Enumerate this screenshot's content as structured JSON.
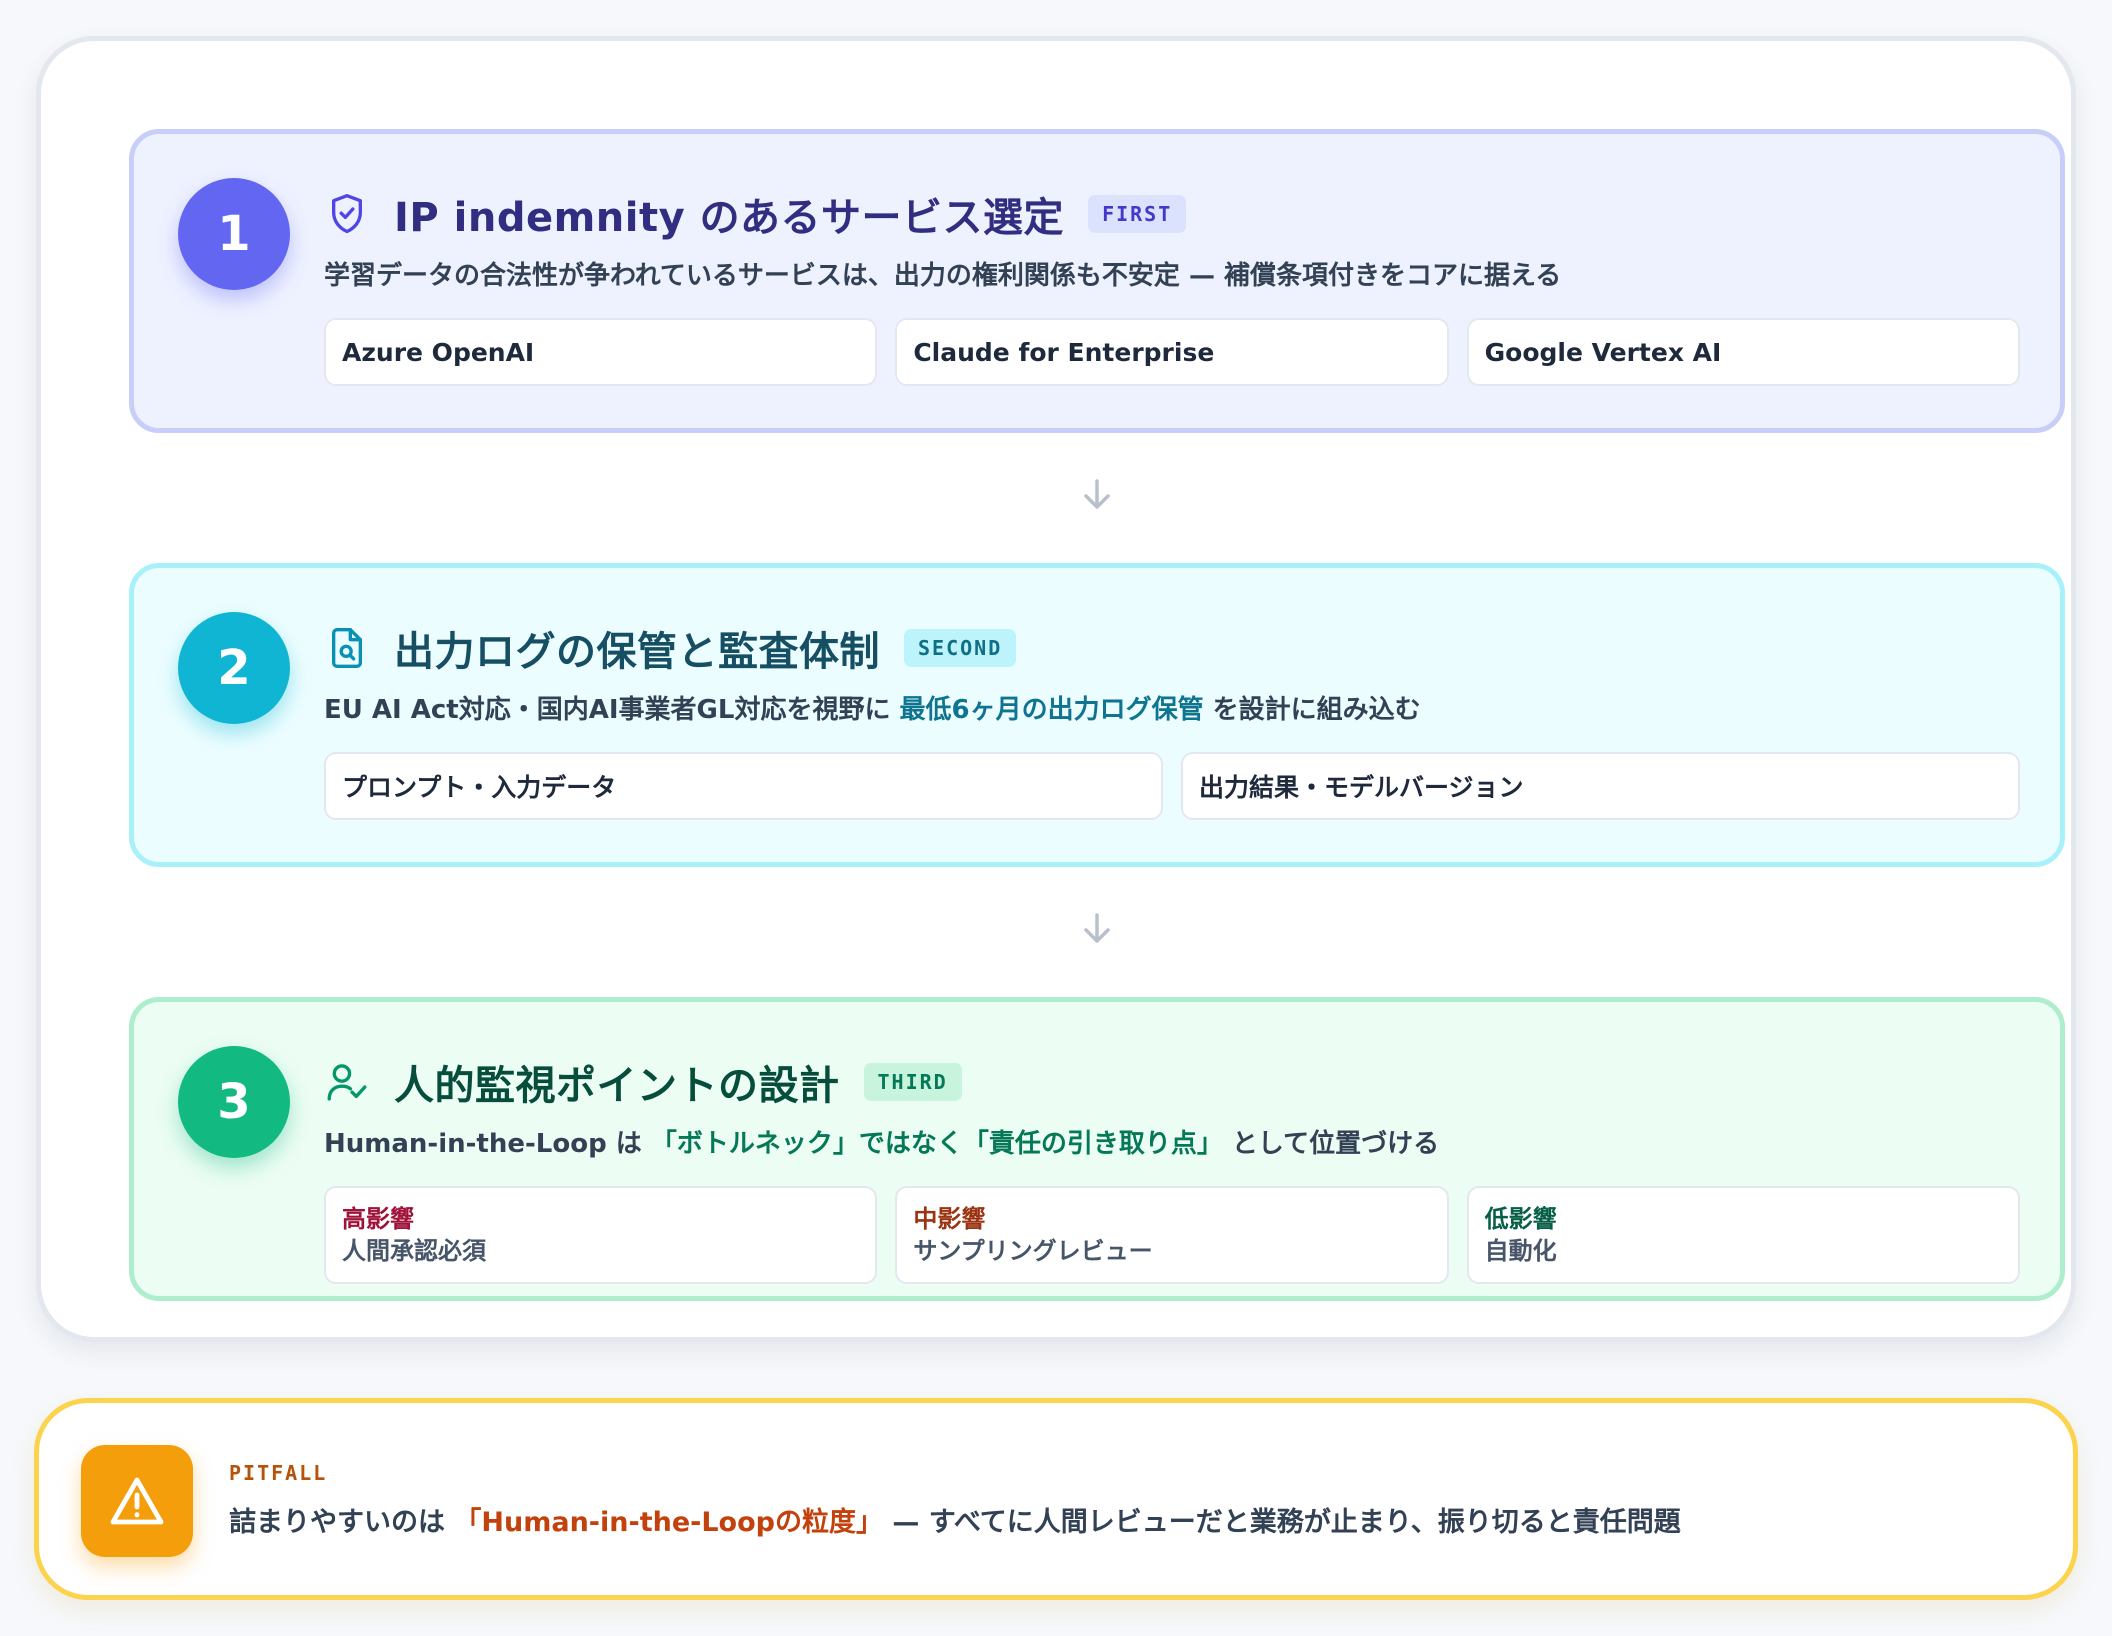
{
  "steps": [
    {
      "number": "1",
      "icon": "shield-check-icon",
      "title": "IP indemnity のあるサービス選定",
      "badge": "FIRST",
      "description": "学習データの合法性が争われているサービスは、出力の権利関係も不安定 — 補償条項付きをコアに据える",
      "items": [
        "Azure OpenAI",
        "Claude for Enterprise",
        "Google Vertex AI"
      ]
    },
    {
      "number": "2",
      "icon": "document-search-icon",
      "title": "出力ログの保管と監査体制",
      "badge": "SECOND",
      "description_pre": "EU AI Act対応・国内AI事業者GL対応を視野に",
      "description_highlight": "最低6ヶ月の出力ログ保管",
      "description_post": "を設計に組み込む",
      "items": [
        "プロンプト・入力データ",
        "出力結果・モデルバージョン"
      ]
    },
    {
      "number": "3",
      "icon": "user-check-icon",
      "title": "人的監視ポイントの設計",
      "badge": "THIRD",
      "description_pre": "Human-in-the-Loop は",
      "description_highlight": "「ボトルネック」ではなく「責任の引き取り点」",
      "description_post": "として位置づける",
      "levels": [
        {
          "key": "高影響",
          "value": "人間承認必須",
          "color": "#9f1239"
        },
        {
          "key": "中影響",
          "value": "サンプリングレビュー",
          "color": "#9a3412"
        },
        {
          "key": "低影響",
          "value": "自動化",
          "color": "#065f46"
        }
      ]
    }
  ],
  "pitfall": {
    "label": "PITFALL",
    "text_pre": "詰まりやすいのは",
    "text_highlight": "「Human-in-the-Loopの粒度」",
    "text_post": "— すべてに人間レビューだと業務が止まり、振り切ると責任問題",
    "icon": "warning-icon"
  }
}
